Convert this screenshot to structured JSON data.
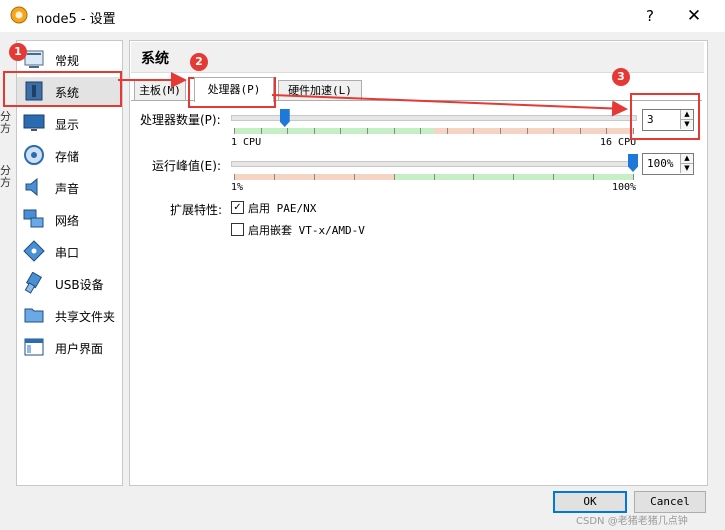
{
  "window": {
    "title": "node5 - 设置",
    "help": "?",
    "close": "✕"
  },
  "edge_text": [
    "分",
    "方",
    "分",
    "方"
  ],
  "sidebar": {
    "items": [
      {
        "label": "常规",
        "icon": "general-icon"
      },
      {
        "label": "系统",
        "icon": "system-icon"
      },
      {
        "label": "显示",
        "icon": "display-icon"
      },
      {
        "label": "存储",
        "icon": "storage-icon"
      },
      {
        "label": "声音",
        "icon": "audio-icon"
      },
      {
        "label": "网络",
        "icon": "network-icon"
      },
      {
        "label": "串口",
        "icon": "serial-port-icon"
      },
      {
        "label": "USB设备",
        "icon": "usb-icon"
      },
      {
        "label": "共享文件夹",
        "icon": "shared-folder-icon"
      },
      {
        "label": "用户界面",
        "icon": "user-interface-icon"
      }
    ]
  },
  "section": {
    "title": "系统"
  },
  "tabs": [
    {
      "label": "主板(M)"
    },
    {
      "label": "处理器(P)"
    },
    {
      "label": "硬件加速(L)"
    }
  ],
  "processor": {
    "cpu_label": "处理器数量(P):",
    "cpu_min": "1 CPU",
    "cpu_max": "16 CPU",
    "cpu_value": "3",
    "cpu_fraction": 0.133,
    "cap_label": "运行峰值(E):",
    "cap_min": "1%",
    "cap_max": "100%",
    "cap_value": "100%",
    "cap_fraction": 1.0,
    "ext_label": "扩展特性:",
    "pae_label": "启用 PAE/NX",
    "pae_checked": true,
    "nested_label": "启用嵌套 VT-x/AMD-V",
    "nested_checked": false
  },
  "buttons": {
    "ok": "OK",
    "cancel": "Cancel"
  },
  "annotations": {
    "markers": [
      "1",
      "2",
      "3"
    ],
    "color": "#e53935"
  },
  "colors": {
    "green_zone": "#c6efc6",
    "orange_zone": "#f7d3c4",
    "slider_thumb": "#1e78d7"
  },
  "watermark": "CSDN @老猪老猪几点钟"
}
